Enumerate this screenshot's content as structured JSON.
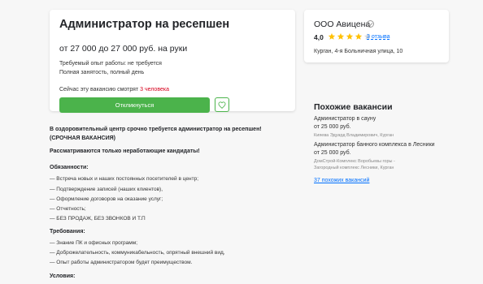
{
  "vacancy": {
    "title": "Администратор на ресепшен",
    "salary": "от 27 000 до 27 000 руб. на руки",
    "experience": "Требуемый опыт работы: не требуется",
    "employment": "Полная занятость, полный день",
    "watching_prefix": "Сейчас эту вакансию смотрят ",
    "watching_count": "3 человека",
    "respond_label": "Откликнуться"
  },
  "employer": {
    "name": "ООО Авицена",
    "rating": "4,0",
    "stars_filled": 4,
    "stars_total": 5,
    "reviews": "3 отзыва",
    "address": "Курган, 4-я Больничная улица, 10"
  },
  "similar": {
    "title": "Похожие вакансии",
    "items": [
      {
        "name": "Администратор в сауну",
        "salary": "от 25 000 руб.",
        "company": "Кияева Эдуард Владимирович, Курган"
      },
      {
        "name": "Администратор банного комплекса в Лесники",
        "salary": "от 25 000 руб.",
        "company": "ДомСтрой-Комплекс Воробьевы горы - Загородный комплекс Лесники, Курган"
      }
    ],
    "more_link": "37 похожих вакансий"
  },
  "description": {
    "intro": "В оздоровительный центр срочно требуется администратор на ресепшен! (СРОЧНАЯ ВАКАНСИЯ)",
    "note": "Рассматриваются только неработающие кандидаты!",
    "duties_title": "Обязанности:",
    "duties": [
      "— Встреча новых и наших постоянных посетителей в центр;",
      "— Подтверждение записей (наших клиентов),",
      "— Оформление договоров на оказание услуг;",
      "— Отчетность;",
      "— БЕЗ ПРОДАЖ, БЕЗ ЗВОНКОВ И Т.П"
    ],
    "requirements_title": "Требования:",
    "requirements": [
      "— Знание ПК и офисных программ;",
      "— Доброжелательность, коммуникабельность, опрятный внешний вид,",
      "— Опыт работы администратором будет преимуществом."
    ],
    "conditions_title": "Условия:"
  },
  "colors": {
    "accent_green": "#4bb34b",
    "link_blue": "#0070ff",
    "star": "#ffc107",
    "alert_red": "#d6001c"
  },
  "icons": [
    "verified-icon",
    "star-icon",
    "heart-icon"
  ]
}
